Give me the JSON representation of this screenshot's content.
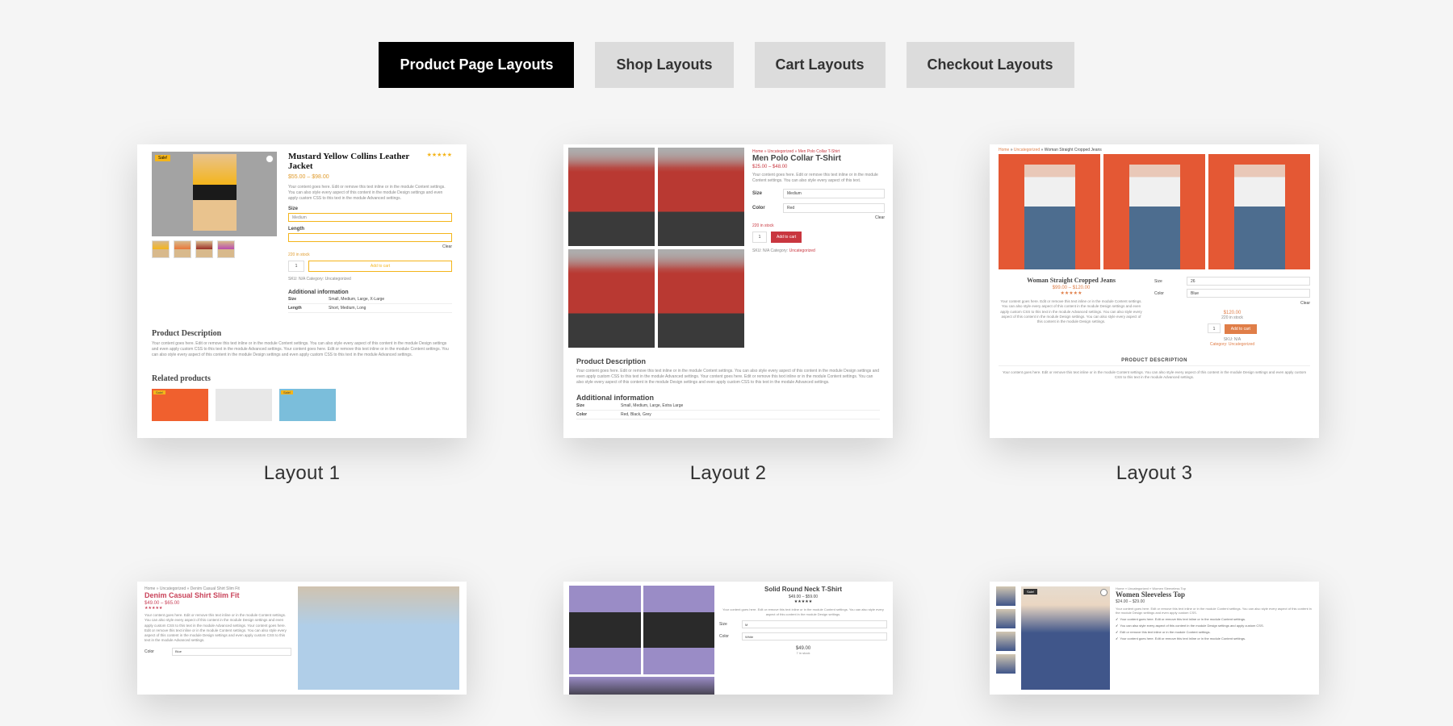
{
  "tabs": [
    {
      "label": "Product Page Layouts",
      "active": true
    },
    {
      "label": "Shop Layouts",
      "active": false
    },
    {
      "label": "Cart Layouts",
      "active": false
    },
    {
      "label": "Checkout Layouts",
      "active": false
    }
  ],
  "layouts": {
    "l1": {
      "label": "Layout 1",
      "title": "Mustard Yellow Collins Leather Jacket",
      "price": "$55.00 – $98.00",
      "size_label": "Size",
      "length_label": "Length",
      "clear": "Clear",
      "instock": "220 in stock",
      "qty": "1",
      "add": "Add to cart",
      "addinfo": "Additional information",
      "row1k": "Size",
      "row1v": "Small, Medium, Large, X-Large",
      "row2k": "Length",
      "row2v": "Short, Medium, Long",
      "pdesc": "Product Description",
      "related": "Related products",
      "sale": "Sale!"
    },
    "l2": {
      "label": "Layout 2",
      "title": "Men Polo Collar T-Shirt",
      "price": "$25.00 – $48.00",
      "size_label": "Size",
      "color_label": "Color",
      "size_val": "Medium",
      "color_val": "Red",
      "clear": "Clear",
      "instock": "220 in stock",
      "qty": "1",
      "add": "Add to cart",
      "sku": "SKU: N/A Category: ",
      "cat": "Uncategorized",
      "pdesc": "Product Description",
      "addinfo": "Additional information",
      "row1k": "Size",
      "row1v": "Small, Medium, Large, Extra Large",
      "row2k": "Color",
      "row2v": "Red, Black, Grey"
    },
    "l3": {
      "label": "Layout 3",
      "title": "Woman Straight Cropped Jeans",
      "price": "$99.00 – $120.00",
      "size_label": "Size",
      "color_label": "Color",
      "size_val": "26",
      "color_val": "Blue",
      "clear": "Clear",
      "pricebox": "$120.00",
      "instock": "220 in stock",
      "qty": "1",
      "add": "Add to cart",
      "sku": "SKU: N/A",
      "cat": "Category: Uncategorized",
      "psec": "PRODUCT DESCRIPTION"
    },
    "l4": {
      "title": "Denim Casual Shirt Slim Fit",
      "price": "$49.00 – $65.00",
      "color_label": "Color",
      "color_val": "Blue"
    },
    "l5": {
      "title": "Solid Round Neck T-Shirt",
      "price": "$49.00 – $59.00",
      "size_label": "Size",
      "color_label": "Color",
      "size_val": "M",
      "color_val": "White",
      "pricebox": "$49.00",
      "stock": "7 in stock"
    },
    "l6": {
      "title": "Women Sleeveless Top",
      "price": "$24.00 – $29.00",
      "badge": "Sale!"
    }
  }
}
